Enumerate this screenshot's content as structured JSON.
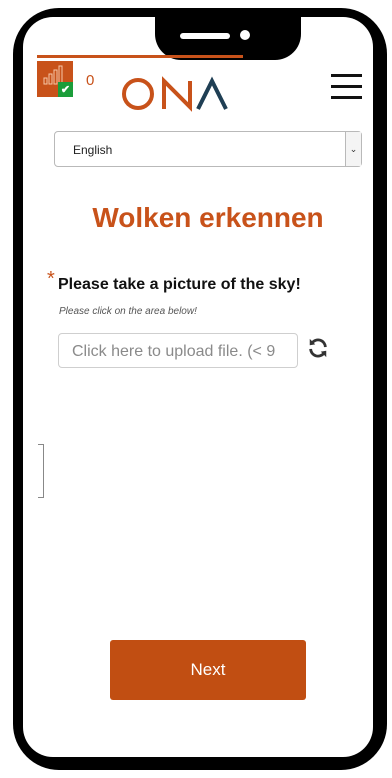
{
  "header": {
    "points_count": "0",
    "logo_text": "ONA"
  },
  "language_select": {
    "selected": "English"
  },
  "survey": {
    "title": "Wolken erkennen",
    "required_marker": "*",
    "question": "Please take a picture of the sky!",
    "hint": "Please click on the area below!",
    "upload_placeholder": "Click here to upload file. (< 9"
  },
  "footer": {
    "next_label": "Next"
  },
  "icons": {
    "stats": "bar-chart-icon",
    "check": "check-icon",
    "menu": "hamburger-menu-icon",
    "dropdown": "chevron-down-icon",
    "refresh": "refresh-icon"
  },
  "colors": {
    "accent": "#c8521a",
    "button": "#c14e12",
    "check": "#1b9d3a"
  }
}
